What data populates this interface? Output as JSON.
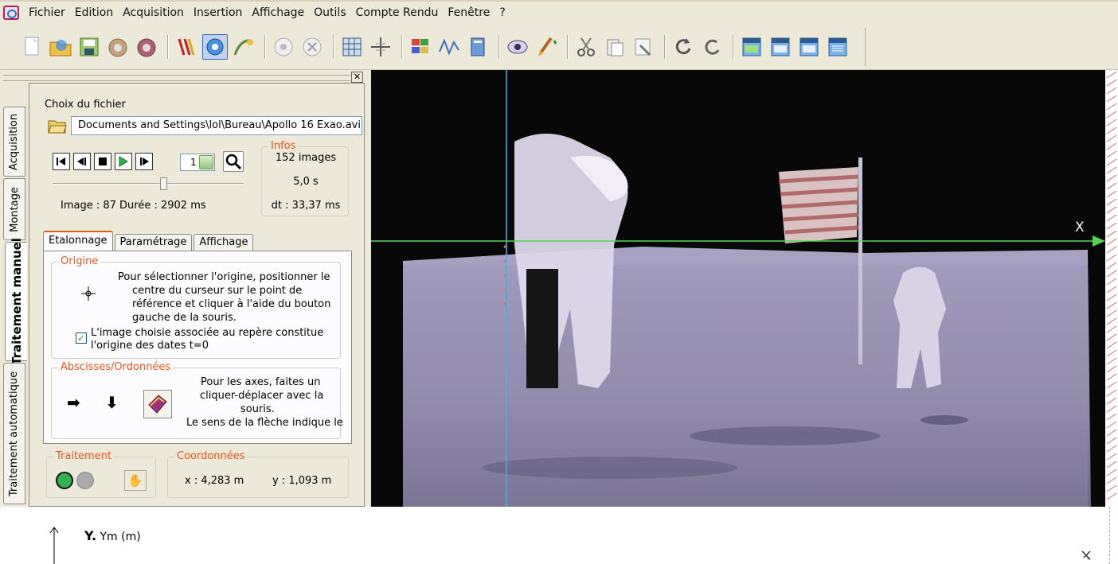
{
  "menu": [
    "Fichier",
    "Edition",
    "Acquisition",
    "Insertion",
    "Affichage",
    "Outils",
    "Compte Rendu",
    "Fenêtre",
    "?"
  ],
  "toolbar_icons": [
    "new-icon",
    "open-folder-icon",
    "save-icon",
    "print-icon",
    "print-preview-icon",
    "magnet-icon",
    "refresh-target-icon",
    "path-icon",
    "circle-icon",
    "close-circle-icon",
    "grid-icon",
    "axes-icon",
    "palette-icon",
    "curve-icon",
    "book-icon",
    "eye-icon",
    "brush-icon",
    "scissors-icon",
    "paste-icon",
    "clear-icon",
    "undo-icon",
    "redo-icon",
    "window-icon-1",
    "window-icon-2",
    "window-icon-3",
    "window-icon-4"
  ],
  "side_tabs": [
    "Acquisition",
    "Montage",
    "Traitement manuel",
    "Traitement automatique"
  ],
  "file": {
    "label": "Choix du fichier",
    "path": "Documents and Settings\\lol\\Bureau\\Apollo 16 Exao.avi"
  },
  "player": {
    "frame_value": "1",
    "image_info": "Image : 87  Durée : 2902 ms",
    "slider_position": 0.58
  },
  "infos": {
    "title": "Infos",
    "images": "152 images",
    "duration": "5,0 s",
    "dt": "dt : 33,37 ms"
  },
  "tabs": [
    "Etalonnage",
    "Paramétrage",
    "Affichage"
  ],
  "origine": {
    "title": "Origine",
    "text_lines": [
      "Pour sélectionner l'origine, positionner le",
      "centre du curseur sur le point de",
      "référence et cliquer à l'aide du bouton",
      "gauche de la souris."
    ],
    "checkbox_line1": "L'image choisie associée au repère constitue",
    "checkbox_line2": "l'origine des dates t=0",
    "checked": true
  },
  "abscisses": {
    "title": "Abscisses/Ordonnées",
    "text_lines": [
      "Pour les axes, faites un",
      "cliquer-déplacer avec la",
      "souris.",
      "Le sens de la flèche indique le"
    ]
  },
  "traitement": {
    "title": "Traitement"
  },
  "coordonnees": {
    "title": "Coordonnées",
    "x": "x : 4,283 m",
    "y": "y : 1,093 m"
  },
  "video": {
    "x_axis_label": "X"
  },
  "lower": {
    "y_label_bold": "Y.",
    "y_label_rest": " Ym (m)"
  }
}
